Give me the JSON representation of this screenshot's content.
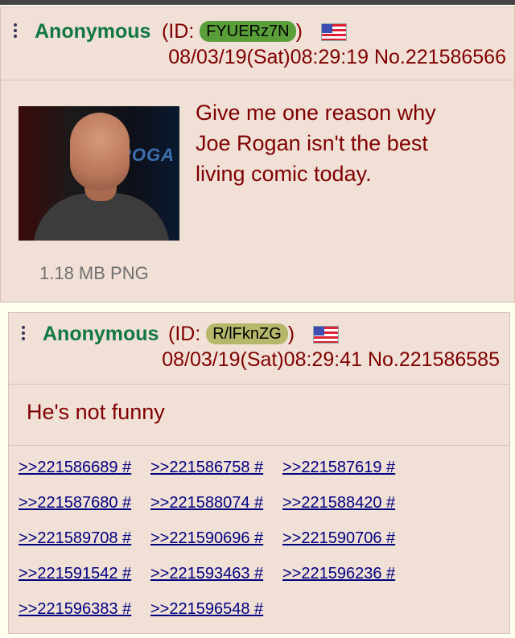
{
  "post1": {
    "name": "Anonymous",
    "id_prefix": "(ID: ",
    "id": "FYUERz7N",
    "id_suffix": ")",
    "id_color": "#5a9e3a",
    "date": "08/03/19(Sat)08:29:19",
    "number": "No.221586566",
    "file_info": "1.18 MB PNG",
    "thumb_sign": "ROGA",
    "comment": [
      "Give me one reason why",
      "Joe Rogan isn't the best",
      "living comic today."
    ]
  },
  "post2": {
    "name": "Anonymous",
    "id_prefix": "(ID: ",
    "id": "R/lFknZG",
    "id_suffix": ")",
    "id_color": "#b5b86a",
    "date": "08/03/19(Sat)08:29:41",
    "number": "No.221586585",
    "comment": "He's not funny",
    "replies": [
      ">>221586689 #",
      ">>221586758 #",
      ">>221587619 #",
      ">>221587680 #",
      ">>221588074 #",
      ">>221588420 #",
      ">>221589708 #",
      ">>221590696 #",
      ">>221590706 #",
      ">>221591542 #",
      ">>221593463 #",
      ">>221596236 #",
      ">>221596383 #",
      ">>221596548 #"
    ]
  }
}
